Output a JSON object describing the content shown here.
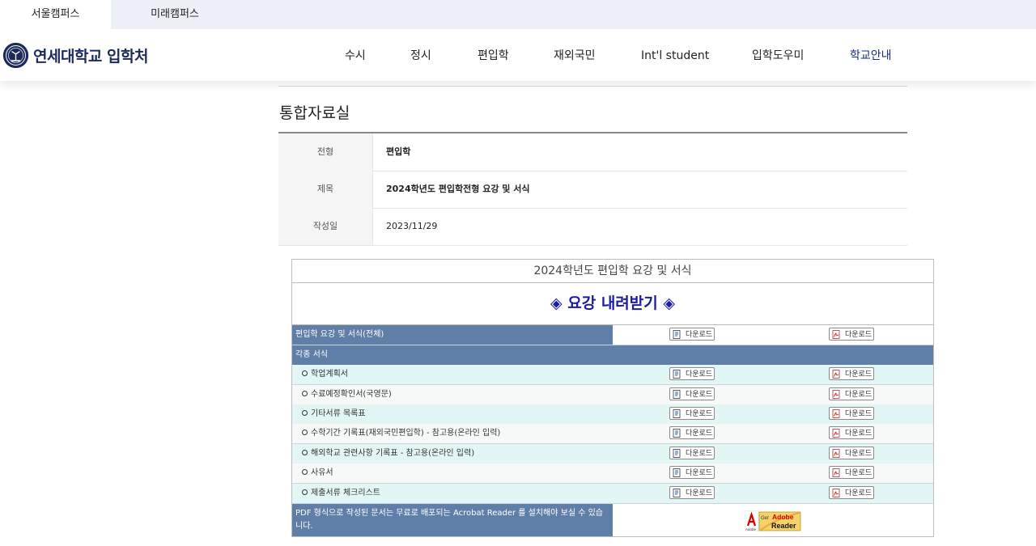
{
  "campus_tabs": [
    "서울캠퍼스",
    "미래캠퍼스"
  ],
  "brand": {
    "name": "연세대학교 입학처"
  },
  "nav": [
    "수시",
    "정시",
    "편입학",
    "재외국민",
    "Int'l student",
    "입학도우미",
    "학교안내"
  ],
  "page_title": "통합자료실",
  "info": [
    {
      "label": "전형",
      "value": "편입학"
    },
    {
      "label": "제목",
      "value": "2024학년도 편입학전형 요강 및 서식"
    },
    {
      "label": "작성일",
      "value": "2023/11/29"
    }
  ],
  "doc": {
    "heading": "2024학년도 편입학 요강 및 서식",
    "banner": "◈ 요강 내려받기 ◈",
    "download_label": "다운로드",
    "full_item": "편입학 요강 및 서식(전체)",
    "section": "각종 서식",
    "items": [
      "학업계획서",
      "수료예정확인서(국영문)",
      "기타서류 목록표",
      "수학기간 기록표(재외국민편입학) - 참고용(온라인 입력)",
      "해외학교 관련사항 기록표 - 참고용(온라인 입력)",
      "사유서",
      "제출서류 체크리스트"
    ],
    "footer_note": "PDF 형식으로 작성된 문서는 무료로 배포되는 Acrobat Reader 를 설치해야 보실 수 있습니다.",
    "adobe_badge": {
      "small": "Adobe",
      "get": "Get",
      "brand": "Adobe",
      "product": "Reader"
    }
  },
  "colors": {
    "nav_current": "#1a2b7a",
    "table_dark": "#5f7fa8",
    "row_tint": "#e3f6f6",
    "banner_text": "#1a1aa6"
  }
}
